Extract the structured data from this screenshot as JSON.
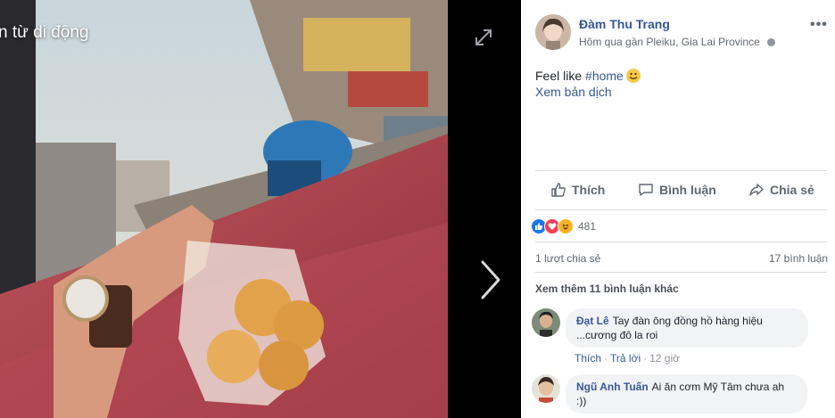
{
  "photo": {
    "album_title": "n từ di động"
  },
  "post": {
    "author": "Đàm Thu Trang",
    "meta": "Hôm qua gần Pleiku, Gia Lai Province",
    "more": "•••",
    "caption_text": "Feel like ",
    "caption_hashtag": "#home",
    "translate": "Xem bản dịch"
  },
  "actions": {
    "like": "Thích",
    "comment": "Bình luận",
    "share": "Chia sẻ"
  },
  "stats": {
    "reaction_count": "481",
    "shares": "1 lượt chia sẻ",
    "comments": "17 bình luận",
    "more_comments": "Xem thêm 11 bình luận khác"
  },
  "comments": [
    {
      "name": "Đạt Lê",
      "line1": "Tay đàn ông đồng hồ hàng hiệu",
      "line2": "...cương đô la roi",
      "like": "Thích",
      "reply": "Trả lời",
      "time": "12 giờ"
    },
    {
      "name": "Ngũ Anh Tuấn",
      "line1": "Ai ăn cơm Mỹ Tâm chưa ah",
      "line2": ":))"
    }
  ],
  "colors": {
    "link": "#365899",
    "like_blue": "#1877f2",
    "love_red": "#f33e58",
    "haha_yellow": "#f7b125"
  },
  "icons": [
    "expand-icon",
    "next-arrow-icon",
    "globe-icon",
    "more-icon",
    "smiley-icon",
    "like-icon",
    "comment-icon",
    "share-icon",
    "like-reaction-icon",
    "love-reaction-icon",
    "haha-reaction-icon"
  ]
}
